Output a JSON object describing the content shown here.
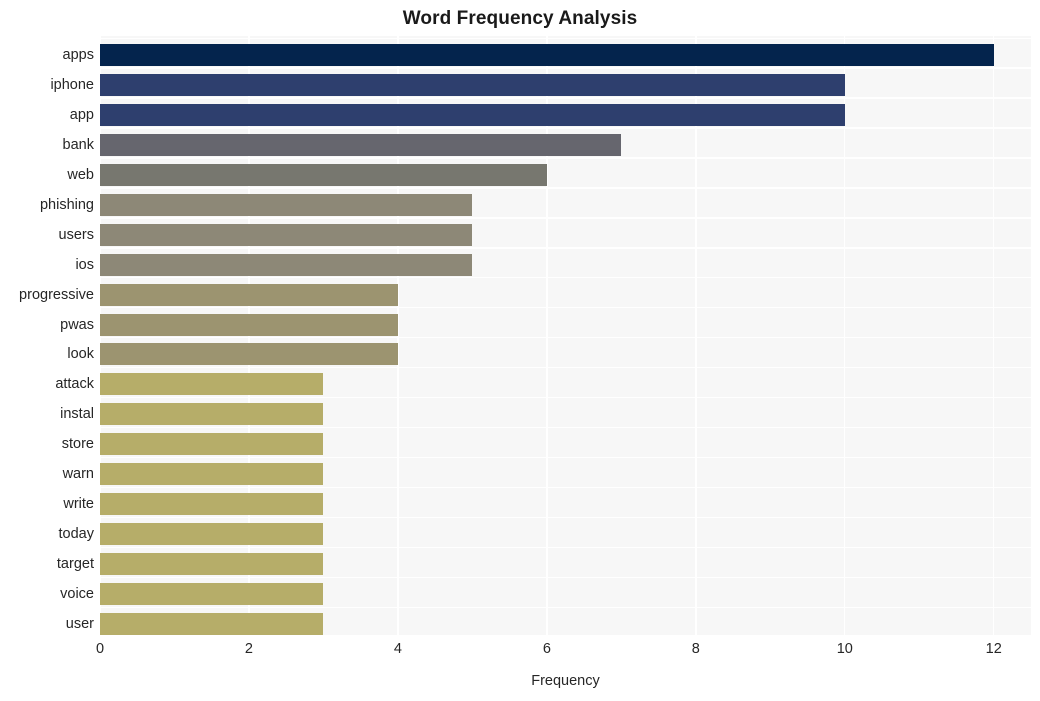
{
  "chart_data": {
    "type": "bar",
    "orientation": "horizontal",
    "title": "Word Frequency Analysis",
    "xlabel": "Frequency",
    "ylabel": "",
    "categories": [
      "apps",
      "iphone",
      "app",
      "bank",
      "web",
      "phishing",
      "users",
      "ios",
      "progressive",
      "pwas",
      "look",
      "attack",
      "instal",
      "store",
      "warn",
      "write",
      "today",
      "target",
      "voice",
      "user"
    ],
    "values": [
      12,
      10,
      10,
      7,
      6,
      5,
      5,
      5,
      4,
      4,
      4,
      3,
      3,
      3,
      3,
      3,
      3,
      3,
      3,
      3
    ],
    "bar_colors": [
      "#04244d",
      "#2e3f६e",
      "#2e3f6e",
      "#66666e",
      "#77776f",
      "#8d8877",
      "#8d8877",
      "#8d8877",
      "#9c9470",
      "#9c9470",
      "#9c9470",
      "#b6ad69",
      "#b6ad69",
      "#b6ad69",
      "#b6ad69",
      "#b6ad69",
      "#b6ad69",
      "#b6ad69",
      "#b6ad69",
      "#b6ad69"
    ],
    "xlim": [
      0,
      12.5
    ],
    "xticks": [
      0,
      2,
      4,
      6,
      8,
      10,
      12
    ],
    "xtick_labels": [
      "0",
      "2",
      "4",
      "6",
      "8",
      "10",
      "12"
    ],
    "grid": true,
    "grid_color": "#ffffff",
    "plot_background": "#f7f7f7",
    "figure_background": "#ffffff",
    "legend": null
  }
}
